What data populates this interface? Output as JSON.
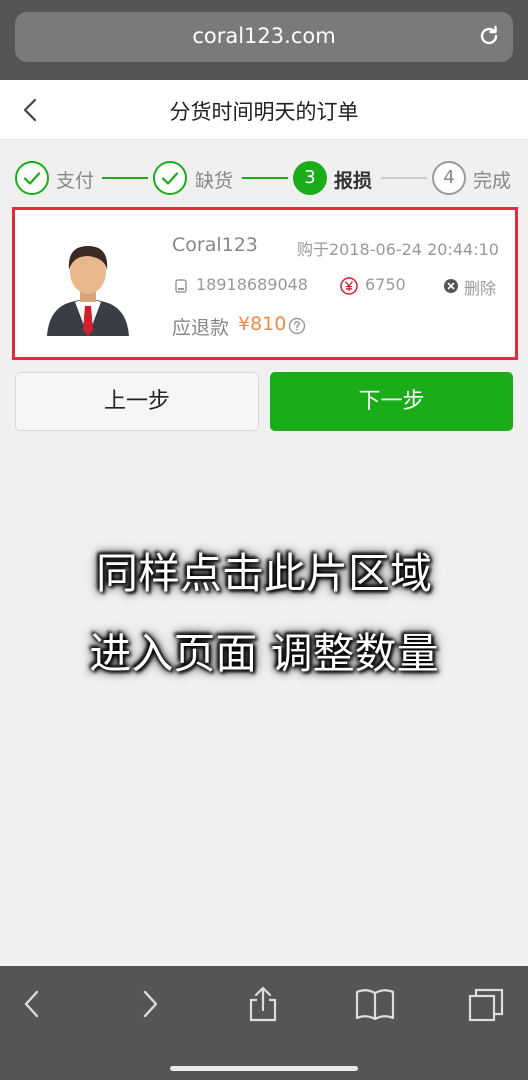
{
  "browser": {
    "url": "coral123.com"
  },
  "header": {
    "title": "分货时间明天的订单"
  },
  "steps": [
    {
      "number": "1",
      "label": "支付",
      "state": "done"
    },
    {
      "number": "2",
      "label": "缺货",
      "state": "done"
    },
    {
      "number": "3",
      "label": "报损",
      "state": "active"
    },
    {
      "number": "4",
      "label": "完成",
      "state": "todo"
    }
  ],
  "order": {
    "customer": "Coral123",
    "purchase_time": "购于2018-06-24 20:44:10",
    "phone": "18918689048",
    "amount": "6750",
    "delete_label": "删除",
    "refund_label": "应退款",
    "refund_amount": "¥810"
  },
  "buttons": {
    "prev": "上一步",
    "next": "下一步"
  },
  "caption": {
    "line1": "同样点击此片区域",
    "line2": "进入页面 调整数量"
  },
  "colors": {
    "accent_green": "#1aad19",
    "highlight_red": "#e12d3b",
    "refund_orange": "#f08a4b"
  }
}
